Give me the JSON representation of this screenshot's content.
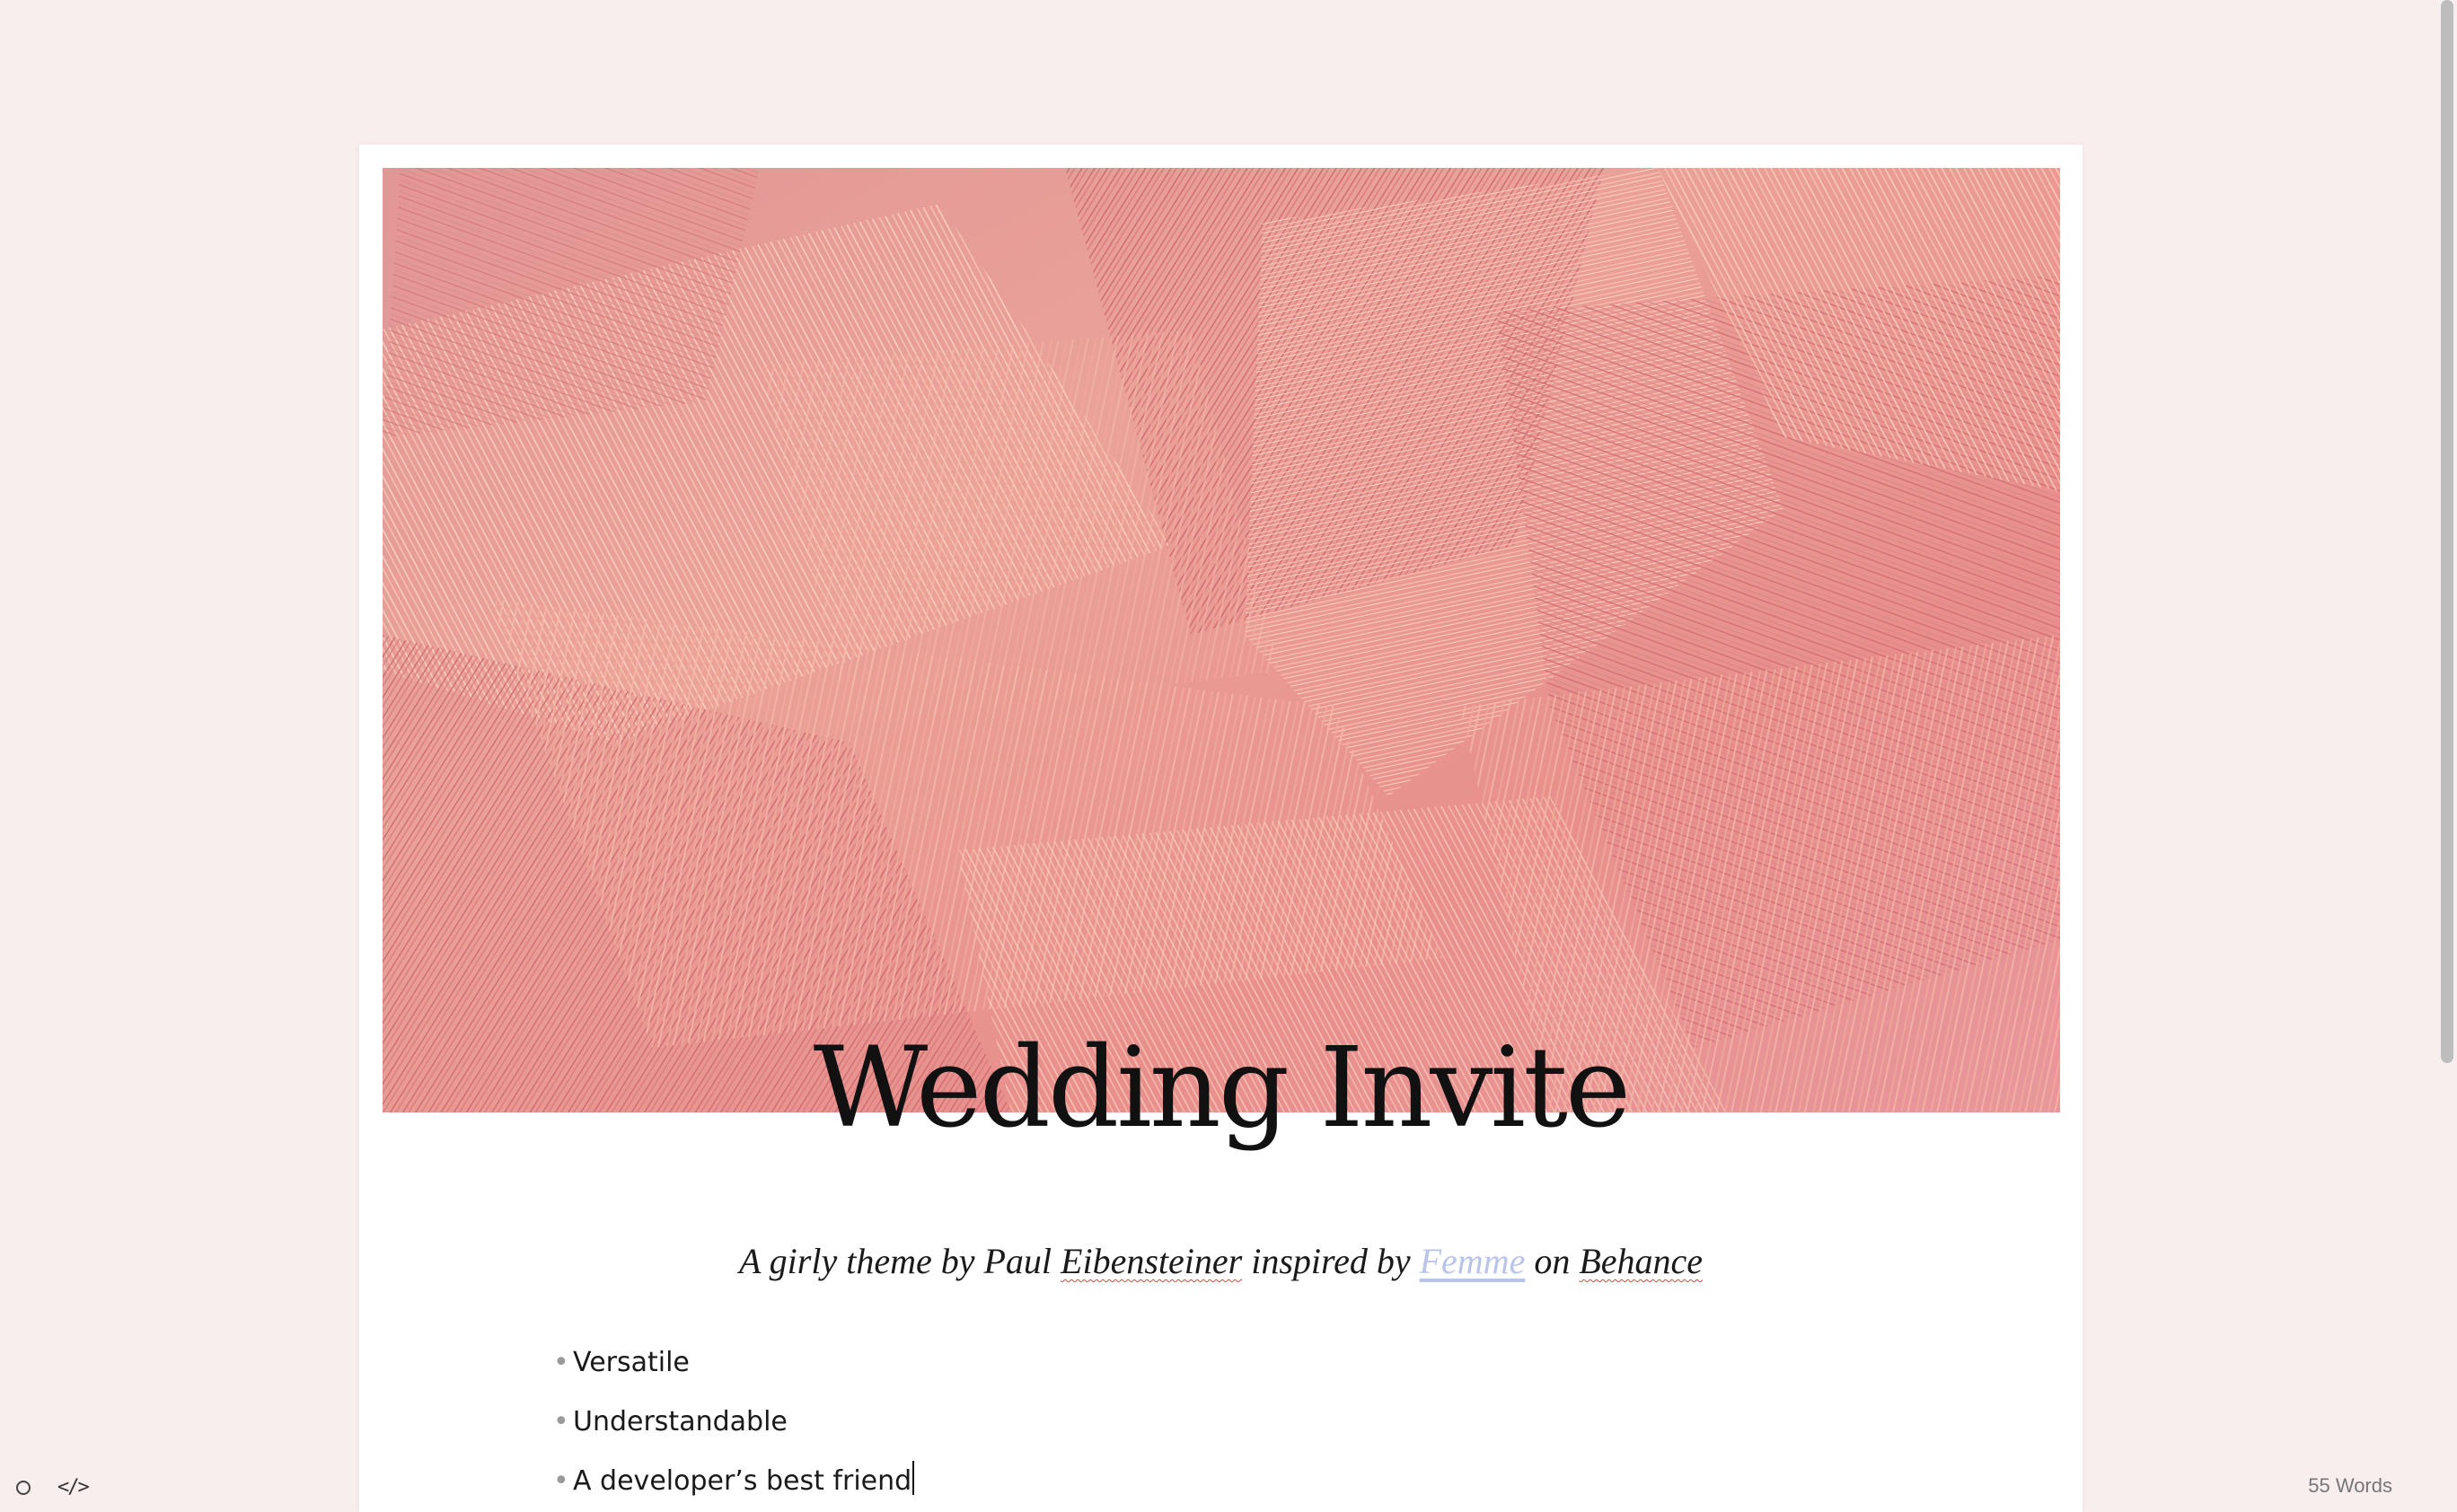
{
  "document": {
    "title": "Wedding Invite",
    "subtitle": {
      "prefix": "A girly theme by Paul ",
      "author_surname": "Eibensteiner",
      "middle": " inspired by ",
      "link_text": "Femme",
      "connector": " on ",
      "platform": "Behance"
    },
    "bullets": [
      "Versatile",
      "Understandable",
      "A developer’s best friend"
    ],
    "bullet_glyph": "•",
    "hero_image": "pink-brush-stroke-texture"
  },
  "footer": {
    "word_count": "55 Words",
    "left_icons": [
      "status-circle-icon",
      "source-code-icon"
    ]
  },
  "colors": {
    "background": "#f9eeee",
    "paper": "#ffffff",
    "link": "#b9c4e8",
    "brush_light": "#f7c4b0",
    "brush_mid": "#e99a98",
    "brush_dark": "#cf6b73"
  }
}
